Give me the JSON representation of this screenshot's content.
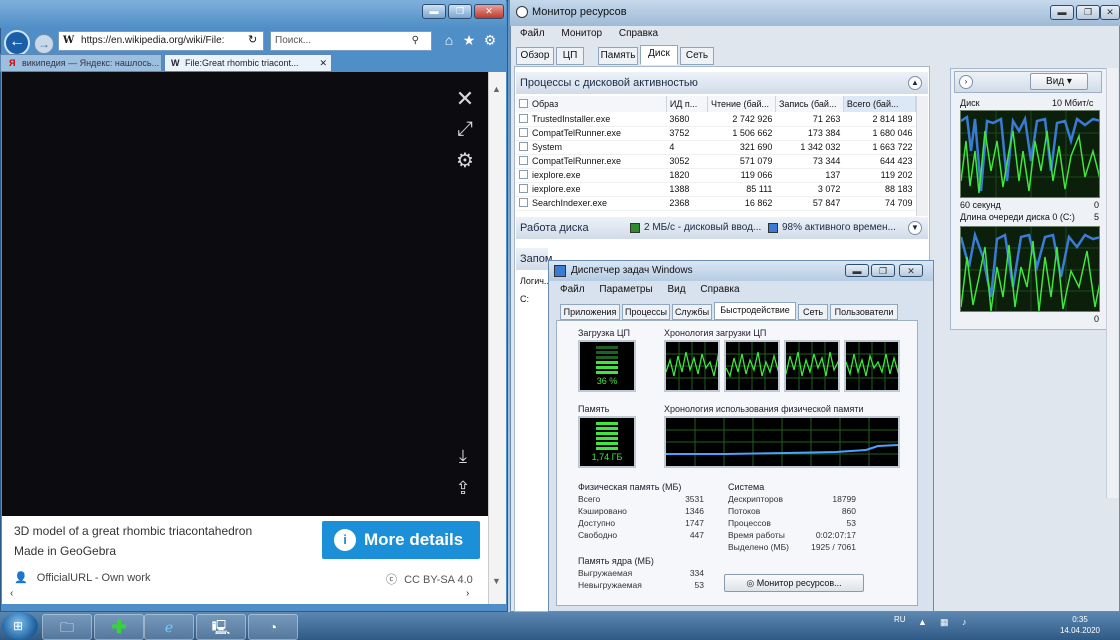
{
  "ie": {
    "url": "https://en.wikipedia.org/wiki/File:",
    "search_placeholder": "Поиск...",
    "tabs": [
      "википедия — Яндекс: нашлось...",
      "File:Great rhombic triacont..."
    ],
    "caption_line1": "3D model of a great rhombic triacontahedron",
    "caption_line2": "Made in GeoGebra",
    "author": "OfficialURL - Own work",
    "license": "CC BY-SA 4.0",
    "more_details": "More details"
  },
  "rm": {
    "title": "Монитор ресурсов",
    "menu": [
      "Файл",
      "Монитор",
      "Справка"
    ],
    "tabs": [
      "Обзор",
      "ЦП",
      "Память",
      "Диск",
      "Сеть"
    ],
    "active_tab": "Диск",
    "section_processes": "Процессы с дисковой активностью",
    "columns": [
      "Образ",
      "ИД п...",
      "Чтение (бай...",
      "Запись (бай...",
      "Всего (бай..."
    ],
    "processes": [
      {
        "name": "TrustedInstaller.exe",
        "pid": "3680",
        "read": "2 742 926",
        "write": "71 263",
        "total": "2 814 189"
      },
      {
        "name": "CompatTelRunner.exe",
        "pid": "3752",
        "read": "1 506 662",
        "write": "173 384",
        "total": "1 680 046"
      },
      {
        "name": "System",
        "pid": "4",
        "read": "321 690",
        "write": "1 342 032",
        "total": "1 663 722"
      },
      {
        "name": "CompatTelRunner.exe",
        "pid": "3052",
        "read": "571 079",
        "write": "73 344",
        "total": "644 423"
      },
      {
        "name": "iexplore.exe",
        "pid": "1820",
        "read": "119 066",
        "write": "137",
        "total": "119 202"
      },
      {
        "name": "iexplore.exe",
        "pid": "1388",
        "read": "85 111",
        "write": "3 072",
        "total": "88 183"
      },
      {
        "name": "SearchIndexer.exe",
        "pid": "2368",
        "read": "16 862",
        "write": "57 847",
        "total": "74 709"
      }
    ],
    "section_disk": "Работа диска",
    "disk_io": "2 МБ/с - дисковый ввод...",
    "disk_active": "98% активного времен...",
    "section_storage": "Запом...",
    "logical_label": "Логич...",
    "drive_c": "C:",
    "view_button": "Вид",
    "graph_disk_label": "Диск",
    "graph_disk_scale": "10 Мбит/с",
    "graph_disk_time": "60 секунд",
    "graph_disk_min": "0",
    "graph_queue_label": "Длина очереди диска 0 (C:)",
    "graph_queue_scale": "5",
    "graph_queue_min": "0"
  },
  "tm": {
    "title": "Диспетчер задач Windows",
    "menu": [
      "Файл",
      "Параметры",
      "Вид",
      "Справка"
    ],
    "tabs": [
      "Приложения",
      "Процессы",
      "Службы",
      "Быстродействие",
      "Сеть",
      "Пользователи"
    ],
    "active_tab": "Быстродействие",
    "cpu_label": "Загрузка ЦП",
    "cpu_value": "36 %",
    "cpu_history_label": "Хронология загрузки ЦП",
    "mem_label": "Память",
    "mem_value": "1,74 ГБ",
    "mem_history_label": "Хронология использования физической памяти",
    "phys_header": "Физическая память (МБ)",
    "phys_rows": [
      {
        "label": "Всего",
        "value": "3531"
      },
      {
        "label": "Кэшировано",
        "value": "1346"
      },
      {
        "label": "Доступно",
        "value": "1747"
      },
      {
        "label": "Свободно",
        "value": "447"
      }
    ],
    "system_header": "Система",
    "system_rows": [
      {
        "label": "Дескрипторов",
        "value": "18799"
      },
      {
        "label": "Потоков",
        "value": "860"
      },
      {
        "label": "Процессов",
        "value": "53"
      },
      {
        "label": "Время работы",
        "value": "0:02:07:17"
      },
      {
        "label": "Выделено (МБ)",
        "value": "1925 / 7061"
      }
    ],
    "kernel_header": "Память ядра (МБ)",
    "kernel_rows": [
      {
        "label": "Выгружаемая",
        "value": "334"
      },
      {
        "label": "Невыгружаемая",
        "value": "53"
      }
    ],
    "rm_button": "Монитор ресурсов..."
  },
  "taskbar": {
    "lang": "RU",
    "time": "0:35",
    "date": "14.04.2020"
  },
  "colors": {
    "accent": "#1b90d8",
    "graph_green": "#3ee63e",
    "graph_blue": "#3a7bd5"
  }
}
